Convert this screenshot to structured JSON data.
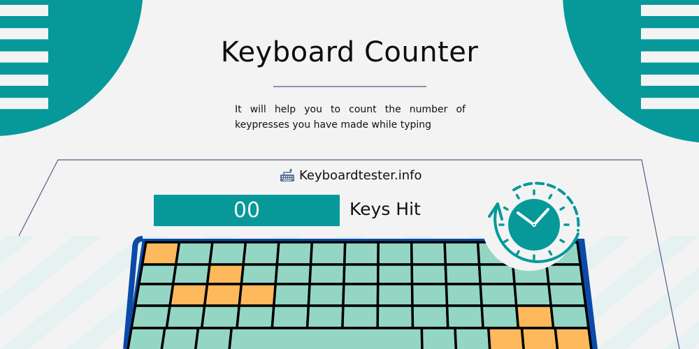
{
  "header": {
    "title": "Keyboard Counter",
    "description": "It will help you to count the number of keypresses you have made while typing"
  },
  "brand": {
    "icon": "keyboard-icon",
    "label": "Keyboardtester.info"
  },
  "counter": {
    "value": "00",
    "label": "Keys Hit"
  },
  "decorations": {
    "clock_icon": "clock-refresh-icon",
    "corner_stripes_icon": "hamburger-stripes-icon"
  },
  "keyboard": {
    "rows": [
      {
        "keys": 13,
        "highlighted": [
          0
        ]
      },
      {
        "keys": 13,
        "highlighted": [
          2
        ]
      },
      {
        "keys": 13,
        "highlighted": [
          1,
          2,
          3
        ]
      },
      {
        "keys": 13,
        "highlighted": [
          11
        ]
      },
      {
        "keys": 9,
        "highlighted": [
          6,
          7,
          8
        ]
      }
    ]
  },
  "colors": {
    "teal": "#07999a",
    "key": "#94d6c4",
    "key_highlight": "#fdb95b",
    "frame": "#0a4aa8",
    "line": "#4a4a7a",
    "background": "#f3f3f3"
  }
}
